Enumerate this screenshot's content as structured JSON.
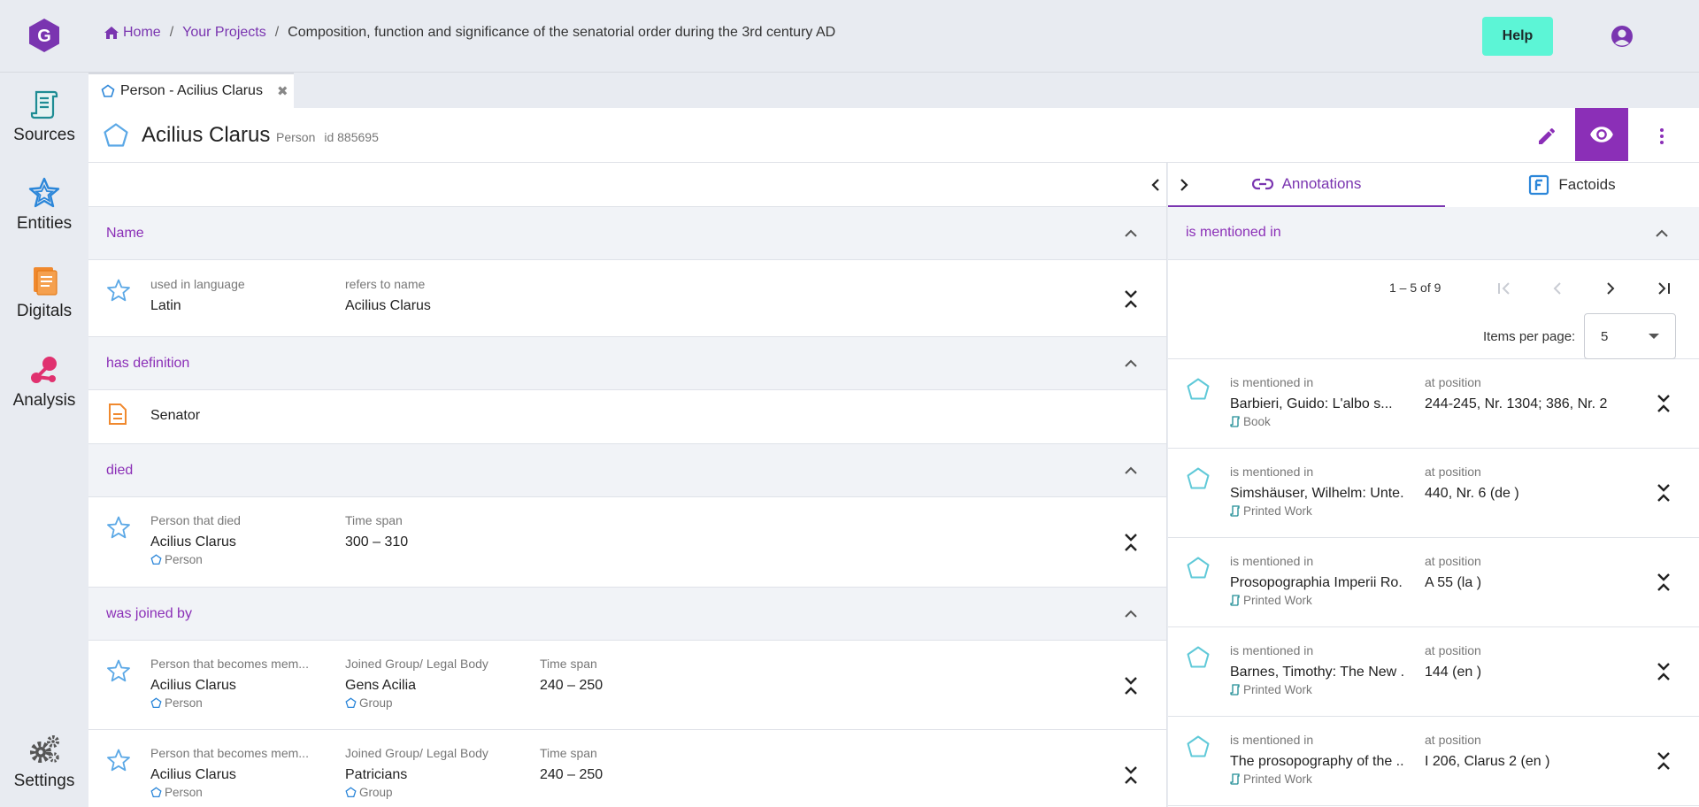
{
  "header": {
    "breadcrumb": {
      "home": "Home",
      "projects": "Your Projects",
      "current": "Composition, function and significance of the senatorial order during the 3rd century AD"
    },
    "help_label": "Help"
  },
  "sidebar": {
    "items": [
      {
        "label": "Sources",
        "icon": "scroll-icon"
      },
      {
        "label": "Entities",
        "icon": "star-icon"
      },
      {
        "label": "Digitals",
        "icon": "file-icon"
      },
      {
        "label": "Analysis",
        "icon": "analysis-icon"
      },
      {
        "label": "Settings",
        "icon": "gear-icon"
      }
    ]
  },
  "tab": {
    "label": "Person - Acilius Clarus",
    "close": "✖"
  },
  "entity": {
    "name": "Acilius Clarus",
    "type": "Person",
    "id": "id 885695"
  },
  "sections": {
    "name": {
      "title": "Name",
      "row": {
        "lang_label": "used in language",
        "lang_value": "Latin",
        "ref_label": "refers to name",
        "ref_value": "Acilius Clarus"
      }
    },
    "definition": {
      "title": "has definition",
      "value": "Senator"
    },
    "died": {
      "title": "died",
      "row": {
        "person_label": "Person that died",
        "person_value": "Acilius Clarus",
        "person_type": "Person",
        "time_label": "Time span",
        "time_value": "300 – 310"
      }
    },
    "joined": {
      "title": "was joined by",
      "rows": [
        {
          "person_label": "Person that becomes mem...",
          "person_value": "Acilius Clarus",
          "person_type": "Person",
          "group_label": "Joined Group/ Legal Body",
          "group_value": "Gens Acilia",
          "group_type": "Group",
          "time_label": "Time span",
          "time_value": "240 – 250"
        },
        {
          "person_label": "Person that becomes mem...",
          "person_value": "Acilius Clarus",
          "person_type": "Person",
          "group_label": "Joined Group/ Legal Body",
          "group_value": "Patricians",
          "group_type": "Group",
          "time_label": "Time span",
          "time_value": "240 – 250"
        }
      ]
    }
  },
  "right": {
    "tabs": {
      "annotations": "Annotations",
      "factoids": "Factoids"
    },
    "section_title": "is mentioned in",
    "pager": {
      "range": "1 – 5 of 9",
      "items_per_page_label": "Items per page:",
      "items_per_page": "5"
    },
    "annotations": [
      {
        "label": "is mentioned in",
        "value": "Barbieri, Guido: L'albo s...",
        "type": "Book",
        "pos_label": "at position",
        "pos_value": "244-245, Nr. 1304; 386, Nr. 2"
      },
      {
        "label": "is mentioned in",
        "value": "Simshäuser, Wilhelm: Unte.",
        "type": "Printed Work",
        "pos_label": "at position",
        "pos_value": "440, Nr. 6 (de )"
      },
      {
        "label": "is mentioned in",
        "value": "Prosopographia Imperii Ro.",
        "type": "Printed Work",
        "pos_label": "at position",
        "pos_value": "A 55 (la )"
      },
      {
        "label": "is mentioned in",
        "value": "Barnes, Timothy: The New .",
        "type": "Printed Work",
        "pos_label": "at position",
        "pos_value": "144 (en )"
      },
      {
        "label": "is mentioned in",
        "value": "The prosopography of the ..",
        "type": "Printed Work",
        "pos_label": "at position",
        "pos_value": "I 206, Clarus 2 (en )"
      }
    ]
  },
  "colors": {
    "accent": "#8b2fb7",
    "help": "#5cf5d6",
    "entity_icon": "#5ba8e6",
    "annotation_icon": "#5fc9d8"
  }
}
